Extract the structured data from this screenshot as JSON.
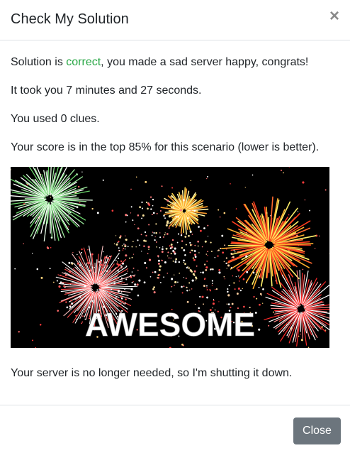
{
  "modal": {
    "title": "Check My Solution",
    "close_icon": "close-icon",
    "close_glyph": "×"
  },
  "body": {
    "solution_prefix": "Solution is ",
    "solution_status": "correct",
    "solution_suffix": ", you made a sad server happy, congrats!",
    "time_text": "It took you 7 minutes and 27 seconds.",
    "clues_text": "You used 0 clues.",
    "score_text": "Your score is in the top 85% for this scenario (lower is better).",
    "image_caption": "AWESOME",
    "shutdown_text": "Your server is no longer needed, so I'm shutting it down."
  },
  "footer": {
    "close_label": "Close"
  },
  "colors": {
    "correct": "#28a745",
    "close_button_bg": "#6c757d"
  }
}
